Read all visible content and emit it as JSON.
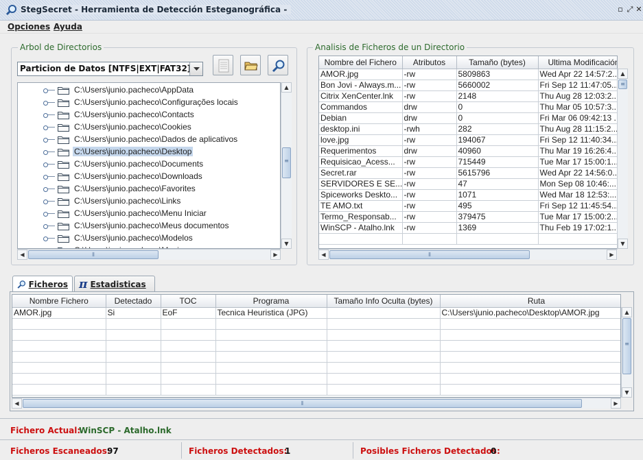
{
  "window": {
    "title": "StegSecret - Herramienta de Detección Esteganográfica -"
  },
  "menu": {
    "items": [
      "Opciones",
      "Ayuda"
    ]
  },
  "tree_panel": {
    "title": "Arbol de Directorios",
    "partition": "Particion de Datos [NTFS|EXT|FAT32]...",
    "items": [
      "C:\\Users\\junio.pacheco\\AppData",
      "C:\\Users\\junio.pacheco\\Configurações locais",
      "C:\\Users\\junio.pacheco\\Contacts",
      "C:\\Users\\junio.pacheco\\Cookies",
      "C:\\Users\\junio.pacheco\\Dados de aplicativos",
      "C:\\Users\\junio.pacheco\\Desktop",
      "C:\\Users\\junio.pacheco\\Documents",
      "C:\\Users\\junio.pacheco\\Downloads",
      "C:\\Users\\junio.pacheco\\Favorites",
      "C:\\Users\\junio.pacheco\\Links",
      "C:\\Users\\junio.pacheco\\Menu Iniciar",
      "C:\\Users\\junio.pacheco\\Meus documentos",
      "C:\\Users\\junio.pacheco\\Modelos",
      "C:\\Users\\junio.pacheco\\Musica"
    ],
    "selected_index": 5
  },
  "files_panel": {
    "title": "Analisis de Ficheros de un Directorio",
    "columns": [
      "Nombre del Fichero",
      "Atributos",
      "Tamaño (bytes)",
      "Ultima Modificación"
    ],
    "rows": [
      [
        "AMOR.jpg",
        "-rw",
        "5809863",
        "Wed Apr 22 14:57:2..."
      ],
      [
        "Bon Jovi - Always.m...",
        "-rw",
        "5660002",
        "Fri Sep 12 11:47:05..."
      ],
      [
        "Citrix XenCenter.lnk",
        "-rw",
        "2148",
        "Thu Aug 28 12:03:2..."
      ],
      [
        "Commandos",
        "drw",
        "0",
        "Thu Mar 05 10:57:3..."
      ],
      [
        "Debian",
        "drw",
        "0",
        "Fri Mar 06 09:42:13 ..."
      ],
      [
        "desktop.ini",
        "-rwh",
        "282",
        "Thu Aug 28 11:15:2..."
      ],
      [
        "love.jpg",
        "-rw",
        "194067",
        "Fri Sep 12 11:40:34..."
      ],
      [
        "Requerimentos",
        "drw",
        "40960",
        "Thu Mar 19 16:26:4..."
      ],
      [
        "Requisicao_Acess...",
        "-rw",
        "715449",
        "Tue Mar 17 15:00:1..."
      ],
      [
        "Secret.rar",
        "-rw",
        "5615796",
        "Wed Apr 22 14:56:0..."
      ],
      [
        "SERVIDORES E SE...",
        "-rw",
        "47",
        "Mon Sep 08 10:46:..."
      ],
      [
        "Spiceworks Deskto...",
        "-rw",
        "1071",
        "Wed Mar 18 12:53:..."
      ],
      [
        "TE AMO.txt",
        "-rw",
        "495",
        "Fri Sep 12 11:45:54..."
      ],
      [
        "Termo_Responsab...",
        "-rw",
        "379475",
        "Tue Mar 17 15:00:2..."
      ],
      [
        "WinSCP - Atalho.lnk",
        "-rw",
        "1369",
        "Thu Feb 19 17:02:1..."
      ]
    ]
  },
  "tabs": [
    "Ficheros",
    "Estadisticas"
  ],
  "results": {
    "columns": [
      "Nombre Fichero",
      "Detectado",
      "TOC",
      "Programa",
      "Tamaño Info Oculta (bytes)",
      "Ruta"
    ],
    "rows": [
      [
        "AMOR.jpg",
        "Si",
        "EoF",
        "Tecnica Heuristica (JPG)",
        "",
        "C:\\Users\\junio.pacheco\\Desktop\\AMOR.jpg"
      ]
    ]
  },
  "status": {
    "current_label": "Fichero Actual:",
    "current_value": "WinSCP - Atalho.lnk",
    "scanned_label": "Ficheros Escaneados:",
    "scanned_value": "97",
    "detected_label": "Ficheros Detectados:",
    "detected_value": "1",
    "possible_label": "Posibles Ficheros Detectados:",
    "possible_value": "0"
  },
  "colors": {
    "accent": "#c5d7ec",
    "label_red": "#cc1010",
    "value_green": "#2c6a2c"
  }
}
